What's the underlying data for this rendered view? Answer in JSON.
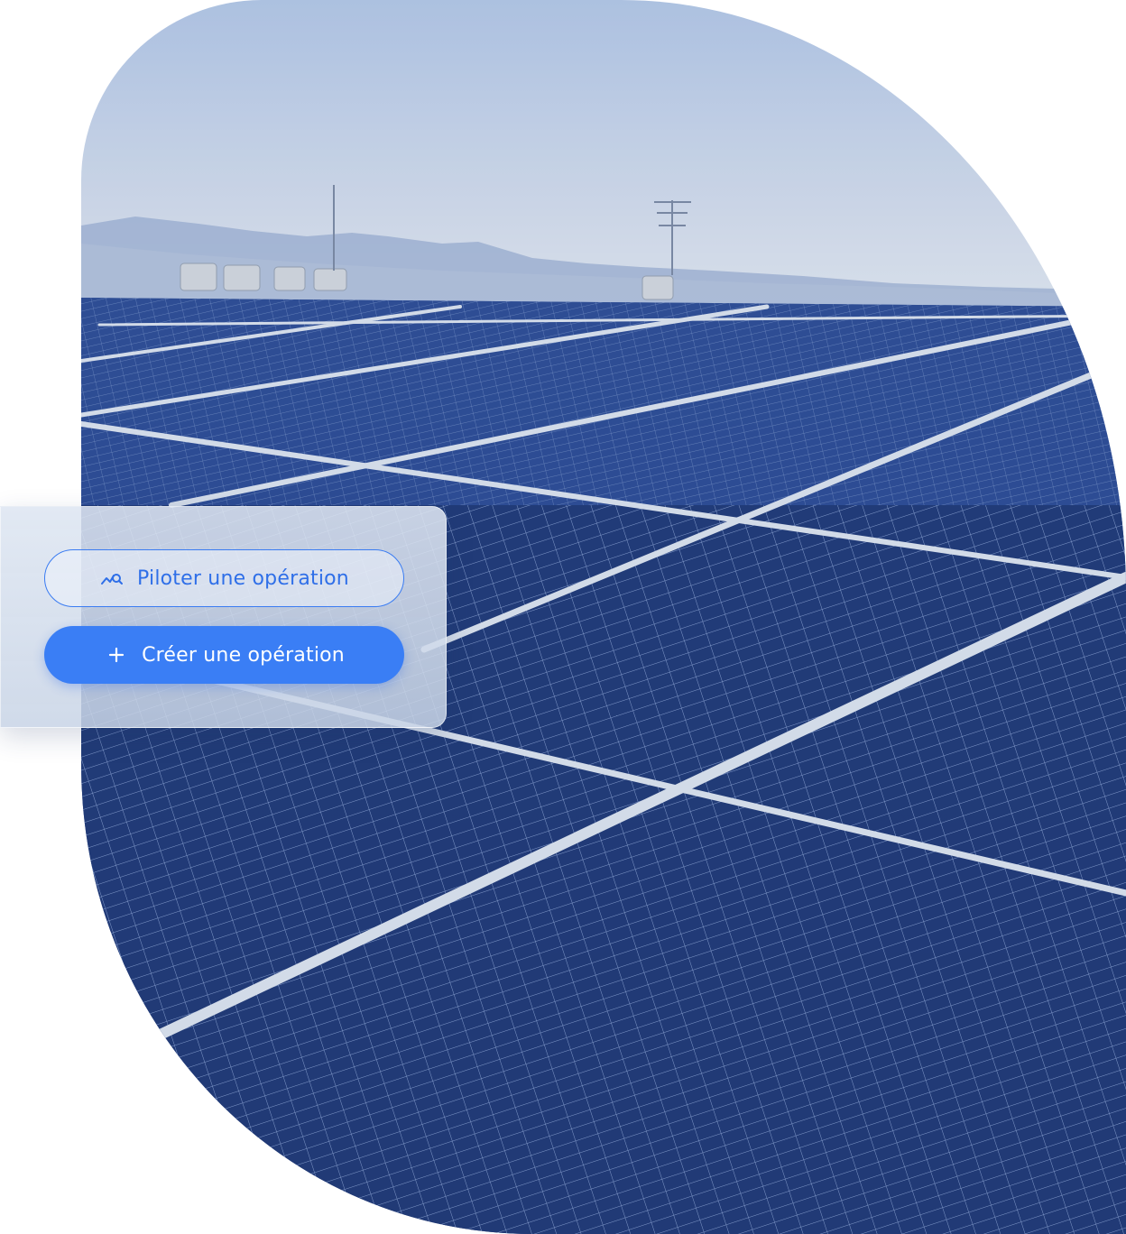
{
  "hero": {
    "image": "solar-panels-rooftop"
  },
  "actions": {
    "pilot": {
      "label": "Piloter une opération",
      "icon": "chart-search-icon"
    },
    "create": {
      "label": "Créer une opération",
      "icon": "plus-icon"
    }
  },
  "colors": {
    "accent": "#3a7ef5",
    "outline_text": "#2f6fe8",
    "sky_top": "#b9cdea",
    "panel": "#24407e"
  }
}
